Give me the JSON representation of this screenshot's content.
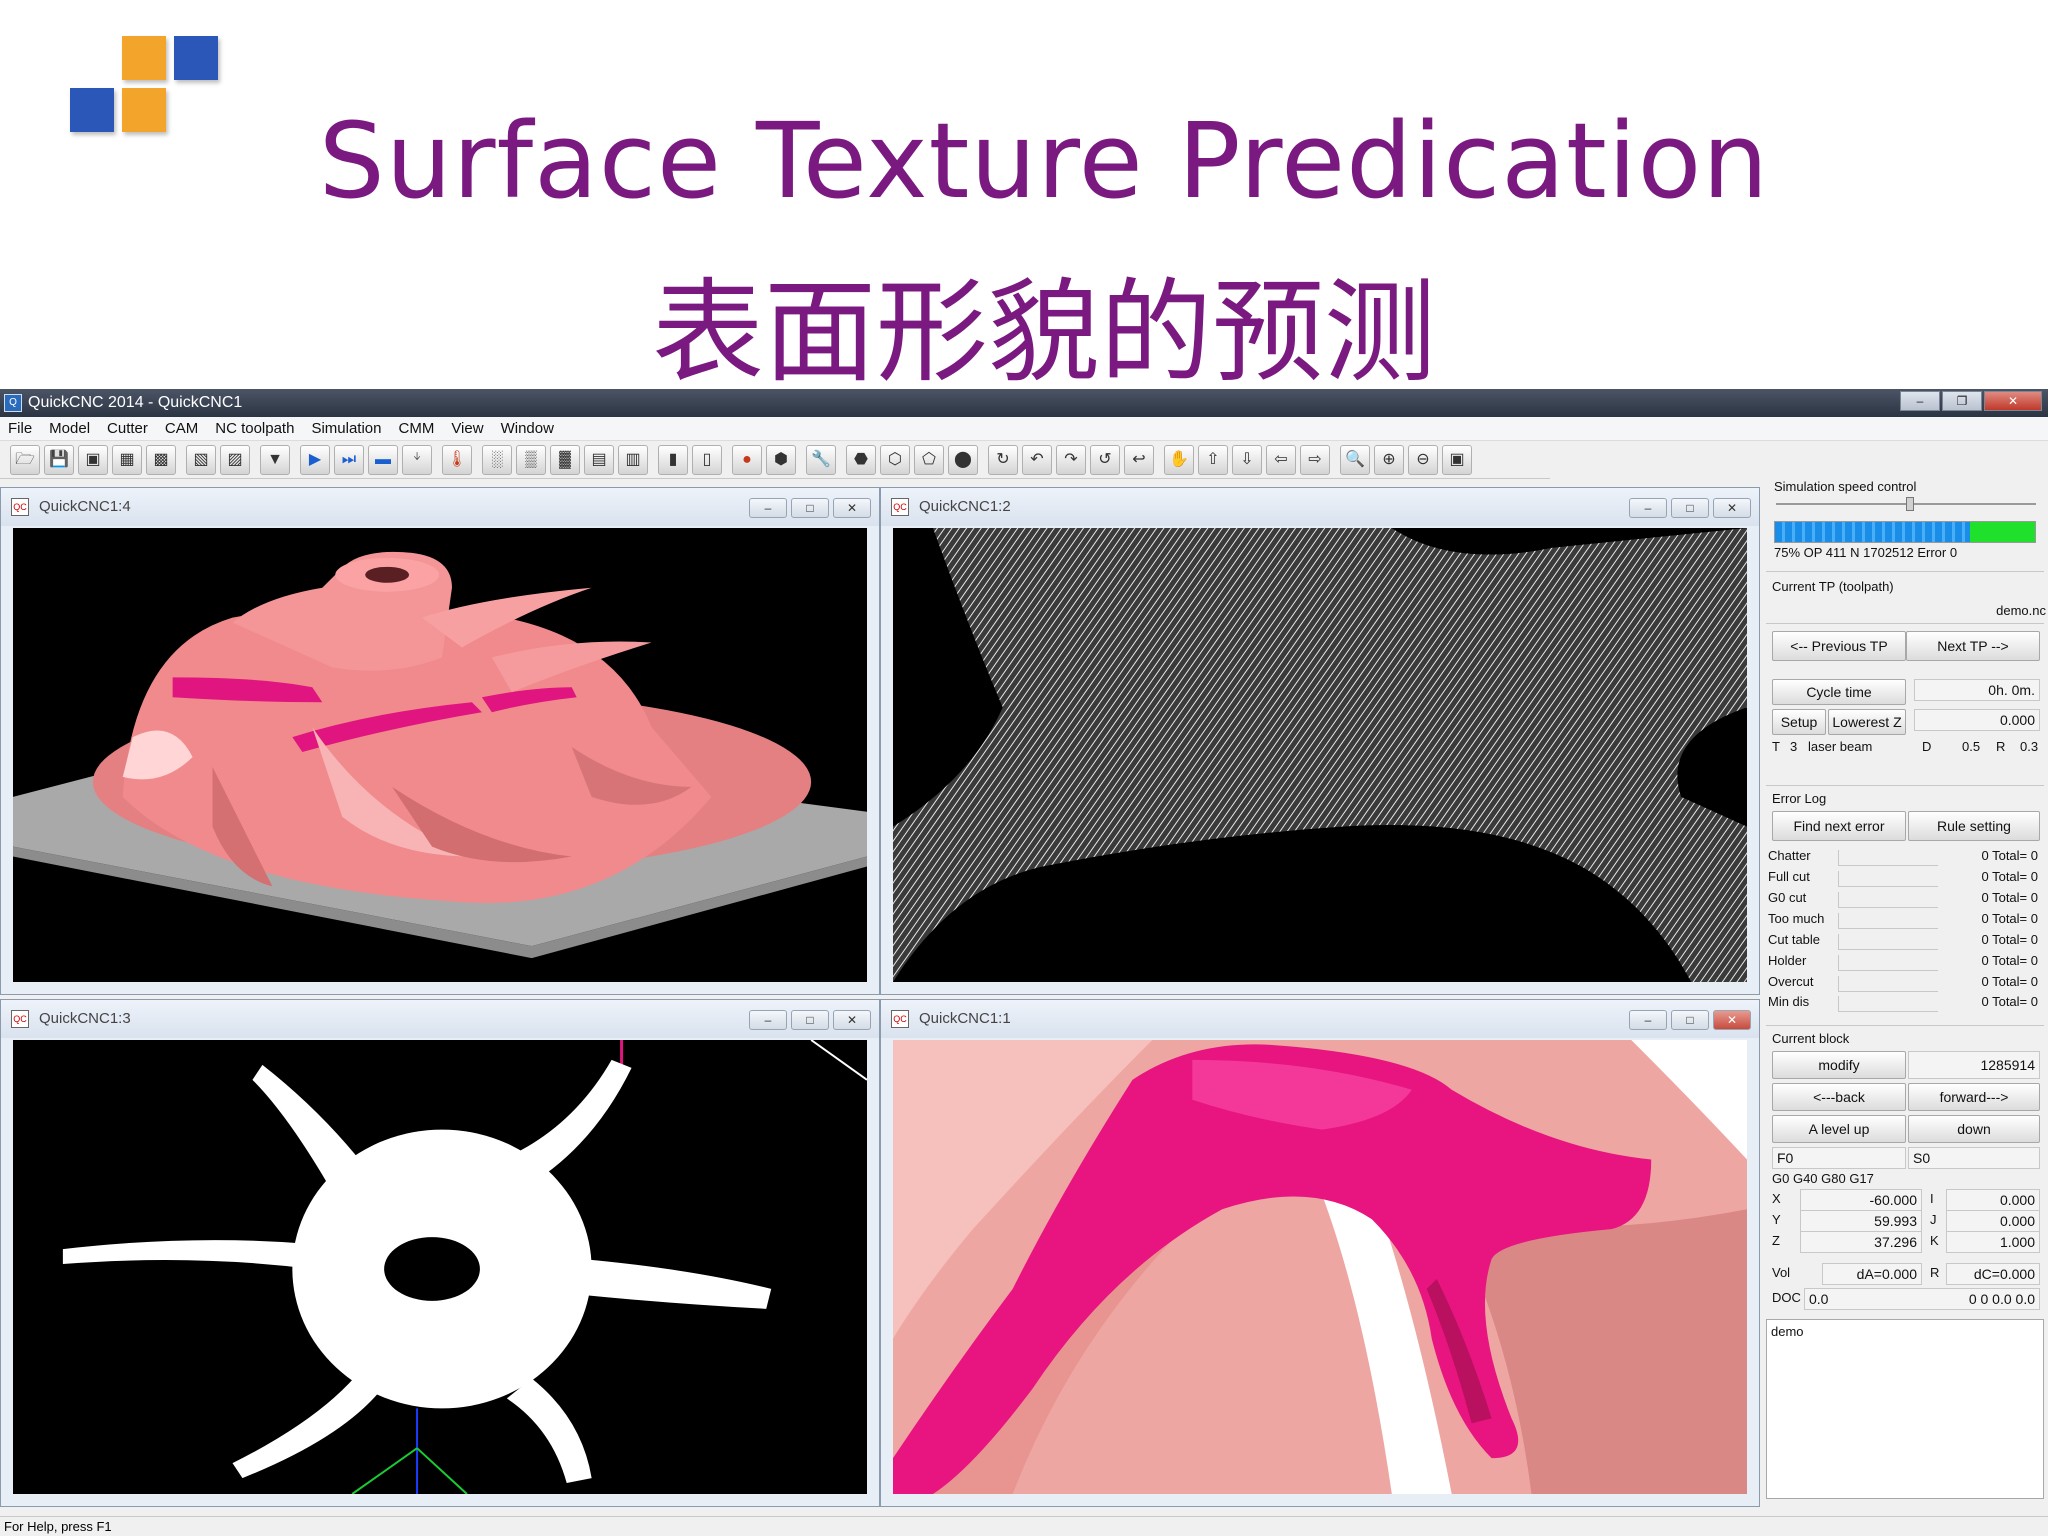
{
  "slide": {
    "title": "Surface Texture Predication",
    "subtitle": "表面形貌的预测"
  },
  "app": {
    "window_title": "QuickCNC 2014 - QuickCNC1",
    "menu": [
      "File",
      "Model",
      "Cutter",
      "CAM",
      "NC toolpath",
      "Simulation",
      "CMM",
      "View",
      "Window"
    ]
  },
  "children": {
    "tl": {
      "title": "QuickCNC1:4"
    },
    "tr": {
      "title": "QuickCNC1:2"
    },
    "bl": {
      "title": "QuickCNC1:3"
    },
    "br": {
      "title": "QuickCNC1:1"
    }
  },
  "panel": {
    "speed_label": "Simulation speed control",
    "progress_percent": 75,
    "progress_text": "75% OP 411    N 1702512  Error 0",
    "current_tp_label": "Current TP (toolpath)",
    "file_name": "demo.nc",
    "prev_tp": "<-- Previous TP",
    "next_tp": "Next TP -->",
    "cycle_time_btn": "Cycle time",
    "cycle_time_val": "0h. 0m.",
    "setup_btn": "Setup",
    "lowerest_z_btn": "Lowerest Z",
    "lowerest_z_val": "0.000",
    "tool_t": "T",
    "tool_num": "3",
    "tool_name": "laser beam",
    "tool_d_label": "D",
    "tool_d": "0.5",
    "tool_r_label": "R",
    "tool_r": "0.3",
    "error_log_label": "Error Log",
    "find_next_error": "Find next error",
    "rule_setting": "Rule setting",
    "errors": [
      {
        "name": "Chatter",
        "value": "0 Total= 0"
      },
      {
        "name": "Full cut",
        "value": "0 Total= 0"
      },
      {
        "name": "G0 cut",
        "value": "0 Total= 0"
      },
      {
        "name": "Too much",
        "value": "0 Total= 0"
      },
      {
        "name": "Cut table",
        "value": "0 Total= 0"
      },
      {
        "name": "Holder",
        "value": "0 Total= 0"
      },
      {
        "name": "Overcut",
        "value": "0 Total= 0"
      },
      {
        "name": "Min dis",
        "value": "0 Total= 0"
      }
    ],
    "current_block_label": "Current block",
    "modify_btn": "modify",
    "block_num": "1285914",
    "back_btn": "<---back",
    "forward_btn": "forward--->",
    "level_up_btn": "A level up",
    "down_btn": "down",
    "f_val": "F0",
    "s_val": "S0",
    "gcodes": "G0  G40  G80  G17",
    "x_label": "X",
    "x_val": "-60.000",
    "i_label": "I",
    "i_val": "0.000",
    "y_label": "Y",
    "y_val": "59.993",
    "j_label": "J",
    "j_val": "0.000",
    "z_label": "Z",
    "z_val": "37.296",
    "k_label": "K",
    "k_val": "1.000",
    "vol_label": "Vol",
    "da_val": "dA=0.000",
    "r_label": "R",
    "dc_val": "dC=0.000",
    "doc_label": "DOC",
    "doc_val": "0.0",
    "doc_right": "0   0   0.0   0.0",
    "notes": "demo"
  },
  "status": {
    "help": "For Help, press F1"
  }
}
